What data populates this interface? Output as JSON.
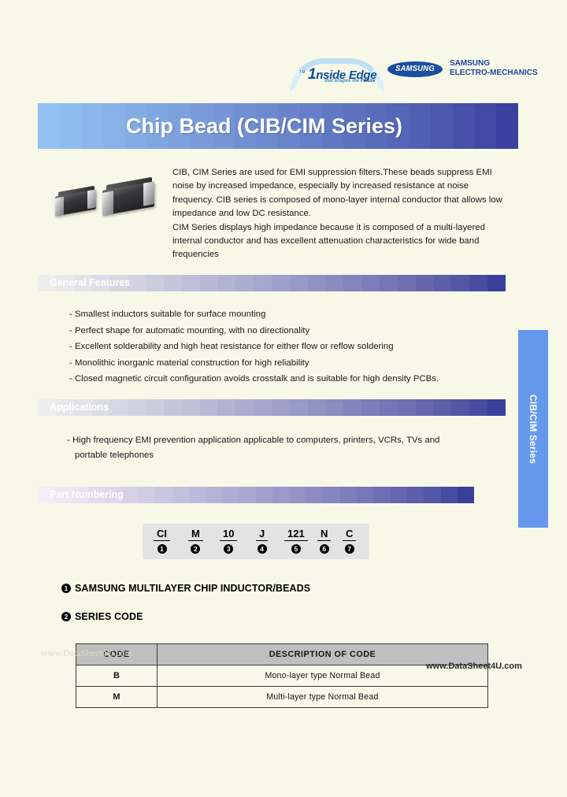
{
  "page": {
    "background_color": "#f8f8e9",
    "title": "Chip Bead (CIB/CIM Series)"
  },
  "header": {
    "inside_edge_logo": {
      "tm": "TM",
      "word_one": "1",
      "word_rest": "nside Edge",
      "tagline_prefix": "that shapes the ",
      "tagline_highlight": "Future"
    },
    "samsung_logo_text": "SAMSUNG",
    "company_line1": "SAMSUNG",
    "company_line2": "ELECTRO-MECHANICS"
  },
  "banner": {
    "title": "Chip Bead (CIB/CIM Series)",
    "gradient_start": "#3b3f9e",
    "gradient_end": "#92c1f2"
  },
  "intro": {
    "paragraph1": "CIB, CIM Series are used for EMI suppression filters.These beads suppress EMI noise by increased impedance, especially by increased resistance at noise frequency. CIB series is composed of mono-layer internal conductor that allows low impedance and low DC resistance.",
    "paragraph2": "CIM Series displays high impedance because it is composed of a multi-layered internal conductor and has excellent attenuation characteristics for wide band frequencies"
  },
  "sections": {
    "general_features": {
      "heading": "General Features",
      "items": [
        "- Smallest inductors suitable for surface mounting",
        "- Perfect shape for automatic mounting, with no directionality",
        "- Excellent solderability and high heat resistance for either flow or reflow soldering",
        "- Monolithic inorganic material construction for high reliability",
        "- Closed magnetic circuit configuration avoids crosstalk and is suitable for high density PCBs."
      ]
    },
    "applications": {
      "heading": "Applications",
      "line1": "- High frequency EMI prevention application applicable to computers, printers, VCRs, TVs and",
      "line2": "portable telephones"
    },
    "part_numbering": {
      "heading": "Part Numbering"
    }
  },
  "side_tab": {
    "label": "CIB/CIM Series",
    "color": "#6699ee"
  },
  "part_number": {
    "segments": [
      {
        "code": "CI",
        "index": "1"
      },
      {
        "code": "M",
        "index": "2"
      },
      {
        "code": "10",
        "index": "3"
      },
      {
        "code": "J",
        "index": "4"
      },
      {
        "code": "121",
        "index": "5"
      },
      {
        "code": "N",
        "index": "6"
      },
      {
        "code": "C",
        "index": "7"
      }
    ]
  },
  "legend": [
    {
      "index": "1",
      "text": "SAMSUNG MULTILAYER CHIP INDUCTOR/BEADS"
    },
    {
      "index": "2",
      "text": "SERIES CODE"
    }
  ],
  "code_table": {
    "headers": [
      "CODE",
      "DESCRIPTION  OF  CODE"
    ],
    "rows": [
      {
        "code": "B",
        "description": "Mono-layer  type  Normal  Bead"
      },
      {
        "code": "M",
        "description": "Multi-layer  type  Normal  Bead"
      }
    ]
  },
  "watermarks": {
    "left_faint": "www.DataSheet4U.com",
    "right_dark": "www.DataSheet4U.com"
  }
}
